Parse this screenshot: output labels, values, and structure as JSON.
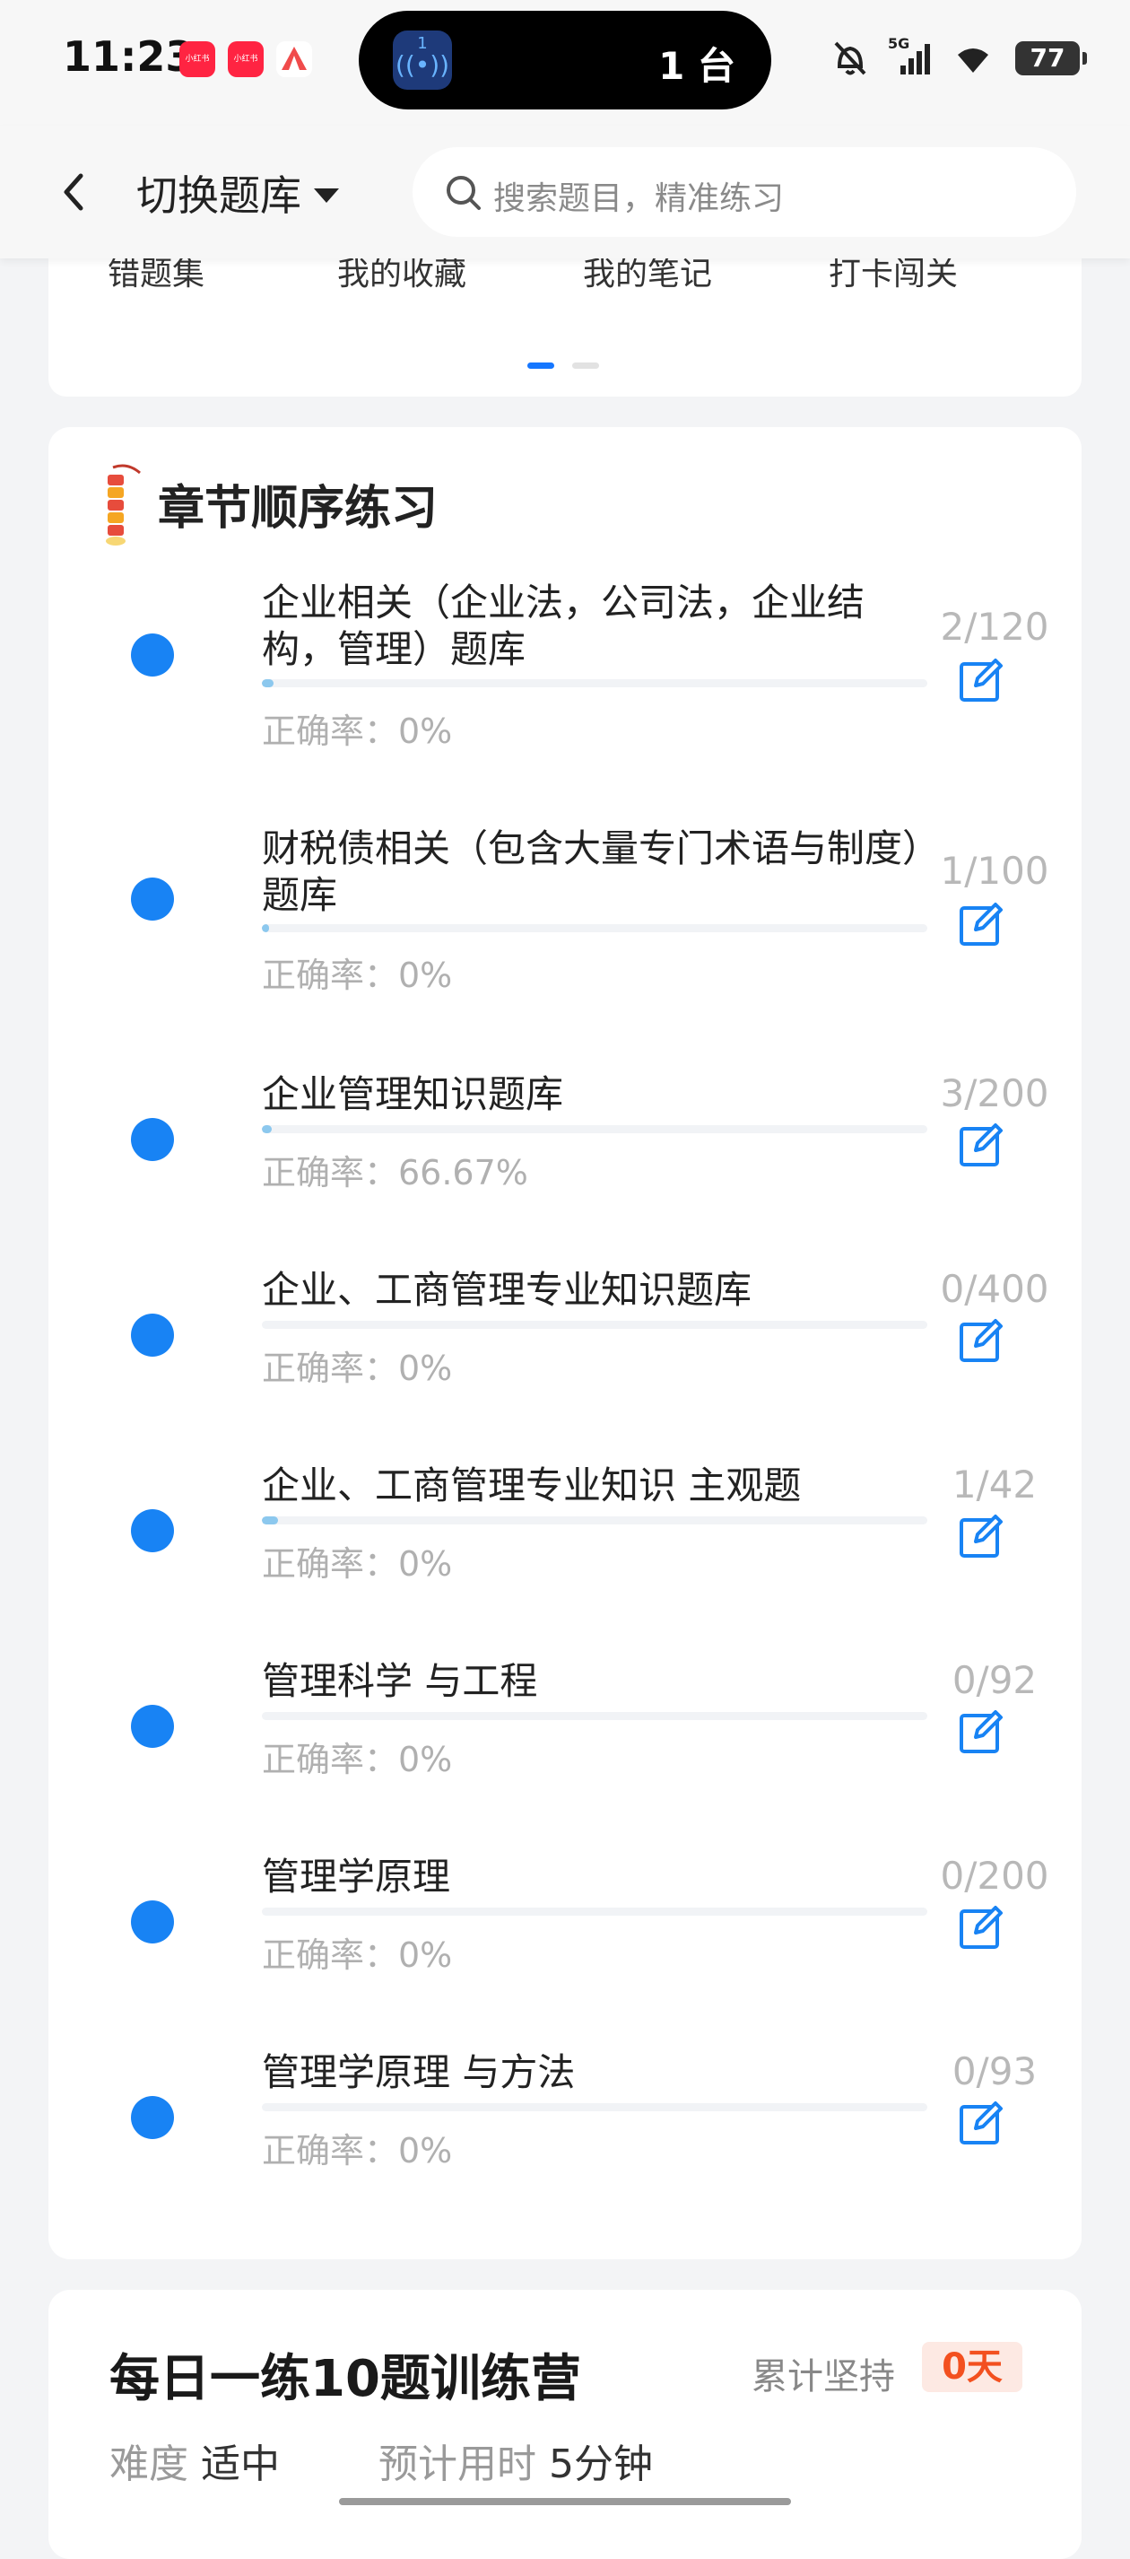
{
  "status_bar": {
    "time": "11:23",
    "app_icons": [
      {
        "name": "xiaohongshu-icon",
        "label": "小红书",
        "color": "#ff2442"
      },
      {
        "name": "xiaohongshu-icon",
        "label": "小红书",
        "color": "#ff2442"
      },
      {
        "name": "red-tent-app-icon",
        "label": "",
        "color": "#f04b4b"
      }
    ],
    "island_app_number": "1",
    "island_text": "1 台",
    "network": "5G",
    "battery": "77"
  },
  "header": {
    "back_icon": "chevron-left-icon",
    "title": "切换题库",
    "search_placeholder": "搜索题目，精准练习"
  },
  "quick_menu": {
    "items": [
      "错题集",
      "我的收藏",
      "我的笔记",
      "打卡闯关"
    ],
    "active_page": 1,
    "page_count": 2
  },
  "chapter_practice": {
    "title": "章节顺序练习",
    "items": [
      {
        "title": "企业相关（企业法，公司法，企业结构，管理）题库",
        "accuracy": "正确率：0%",
        "count": "2/120",
        "progress": 0.017
      },
      {
        "title": "财税债相关（包含大量专门术语与制度）题库",
        "accuracy": "正确率：0%",
        "count": "1/100",
        "progress": 0.01
      },
      {
        "title": "企业管理知识题库",
        "accuracy": "正确率：66.67%",
        "count": "3/200",
        "progress": 0.015
      },
      {
        "title": "企业、工商管理专业知识题库",
        "accuracy": "正确率：0%",
        "count": "0/400",
        "progress": 0
      },
      {
        "title": "企业、工商管理专业知识 主观题",
        "accuracy": "正确率：0%",
        "count": "1/42",
        "progress": 0.024
      },
      {
        "title": "管理科学 与工程",
        "accuracy": "正确率：0%",
        "count": "0/92",
        "progress": 0
      },
      {
        "title": "管理学原理",
        "accuracy": "正确率：0%",
        "count": "0/200",
        "progress": 0
      },
      {
        "title": "管理学原理 与方法",
        "accuracy": "正确率：0%",
        "count": "0/93",
        "progress": 0
      }
    ]
  },
  "daily_camp": {
    "title": "每日一练10题训练营",
    "persist_label": "累计坚持",
    "days": "0天",
    "difficulty_label": "难度",
    "difficulty_value": "适中",
    "time_label": "预计用时",
    "time_value": "5分钟"
  },
  "colors": {
    "accent": "#1883f4",
    "progress_fill": "#8cc8ee",
    "streak_badge_text": "#f3501f",
    "streak_badge_bg": "#fde9e3"
  }
}
